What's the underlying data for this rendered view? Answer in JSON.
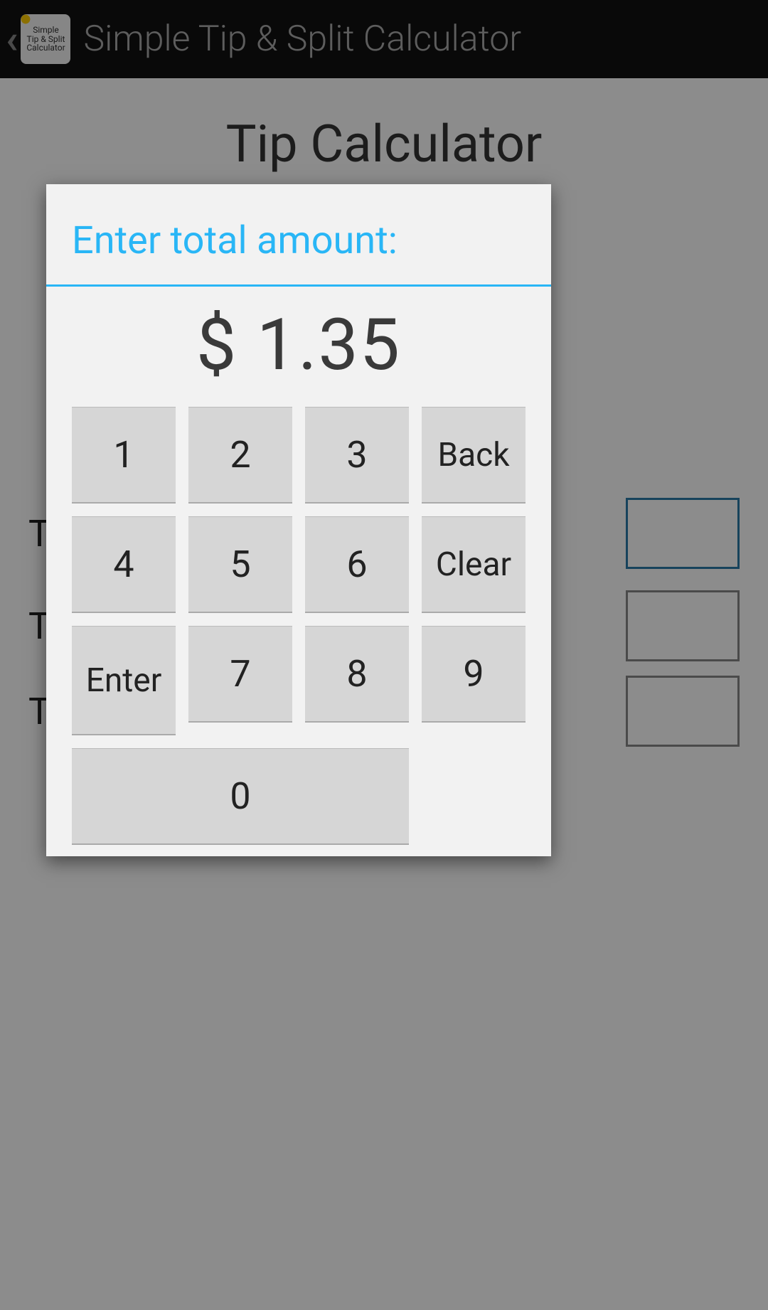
{
  "actionbar": {
    "title": "Simple Tip & Split Calculator",
    "icon_line1": "Simple",
    "icon_line2": "Tip & Split",
    "icon_line3": "Calculator"
  },
  "page": {
    "title": "Tip Calculator",
    "row1_label": "T",
    "row2_label": "T",
    "row3_label": "T"
  },
  "dialog": {
    "title": "Enter total amount:",
    "amount": "$ 1.35",
    "keys": {
      "k1": "1",
      "k2": "2",
      "k3": "3",
      "back": "Back",
      "k4": "4",
      "k5": "5",
      "k6": "6",
      "clear": "Clear",
      "k7": "7",
      "k8": "8",
      "k9": "9",
      "enter": "Enter",
      "k0": "0"
    }
  }
}
